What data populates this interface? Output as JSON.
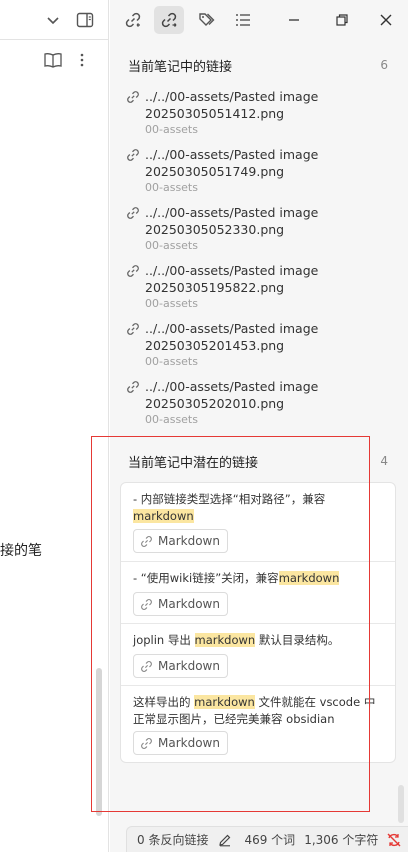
{
  "left_pane": {
    "editor_text_fragment": "接的笔"
  },
  "right_panel": {
    "toolbar": {
      "icons": [
        "backlinks-icon",
        "outgoing-links-icon",
        "tags-icon",
        "outline-icon"
      ],
      "window_buttons": [
        "minimize-icon",
        "restore-icon",
        "close-icon"
      ]
    },
    "outgoing_section": {
      "title": "当前笔记中的链接",
      "count": "6",
      "links": [
        {
          "path": "../../00-assets/Pasted image 20250305051412.png",
          "folder": "00-assets"
        },
        {
          "path": "../../00-assets/Pasted image 20250305051749.png",
          "folder": "00-assets"
        },
        {
          "path": "../../00-assets/Pasted image 20250305052330.png",
          "folder": "00-assets"
        },
        {
          "path": "../../00-assets/Pasted image 20250305195822.png",
          "folder": "00-assets"
        },
        {
          "path": "../../00-assets/Pasted image 20250305201453.png",
          "folder": "00-assets"
        },
        {
          "path": "../../00-assets/Pasted image 20250305202010.png",
          "folder": "00-assets"
        }
      ]
    },
    "unlinked_section": {
      "title": "当前笔记中潜在的链接",
      "count": "4",
      "button_label": "Markdown",
      "items": [
        {
          "before": "- 内部链接类型选择“相对路径”，兼容 ",
          "match": "markdown",
          "after": ""
        },
        {
          "before": "- “使用wiki链接”关闭，兼容",
          "match": "markdown",
          "after": ""
        },
        {
          "before": "joplin 导出 ",
          "match": "markdown",
          "after": " 默认目录结构。"
        },
        {
          "before": "这样导出的 ",
          "match": "markdown",
          "after": " 文件就能在 vscode 中正常显示图片，已经完美兼容 obsidian"
        }
      ]
    }
  },
  "status_bar": {
    "backlinks": "0 条反向链接",
    "words": "469 个词",
    "chars": "1,306 个字符"
  },
  "colors": {
    "highlight": "#fbe6a1",
    "annotation_box": "#e53935",
    "sync_off_icon": "#e53935"
  }
}
